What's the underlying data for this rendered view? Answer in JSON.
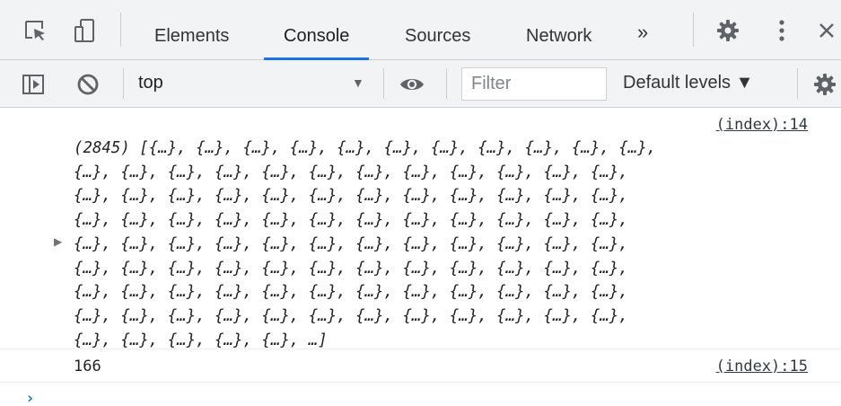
{
  "tabbar": {
    "tabs": [
      {
        "label": "Elements"
      },
      {
        "label": "Console"
      },
      {
        "label": "Sources"
      },
      {
        "label": "Network"
      }
    ],
    "more_tabs_label": "»",
    "active_tab": "Console"
  },
  "toolbar": {
    "context_label": "top",
    "filter_placeholder": "Filter",
    "levels_label": "Default levels ▼"
  },
  "console": {
    "messages": [
      {
        "source": "(index):14",
        "lines": [
          "(2845) [{…}, {…}, {…}, {…}, {…}, {…}, {…}, {…}, {…}, {…}, {…},",
          "{…}, {…}, {…}, {…}, {…}, {…}, {…}, {…}, {…}, {…}, {…}, {…},",
          "{…}, {…}, {…}, {…}, {…}, {…}, {…}, {…}, {…}, {…}, {…}, {…},",
          "{…}, {…}, {…}, {…}, {…}, {…}, {…}, {…}, {…}, {…}, {…}, {…},",
          "{…}, {…}, {…}, {…}, {…}, {…}, {…}, {…}, {…}, {…}, {…}, {…},",
          "{…}, {…}, {…}, {…}, {…}, {…}, {…}, {…}, {…}, {…}, {…}, {…},",
          "{…}, {…}, {…}, {…}, {…}, {…}, {…}, {…}, {…}, {…}, {…}, {…},",
          "{…}, {…}, {…}, {…}, {…}, {…}, {…}, {…}, {…}, {…}, {…}, {…},",
          "{…}, {…}, {…}, {…}, {…}, …]"
        ]
      },
      {
        "value": "166",
        "source": "(index):15"
      }
    ],
    "prompt_symbol": "›"
  },
  "colors": {
    "accent": "#1a73e8",
    "toolbar_bg": "#f1f3f4",
    "border": "#cacdd1"
  },
  "icons": {
    "tabbar": [
      "inspect-element-icon",
      "device-toolbar-icon",
      "settings-gear-icon",
      "more-vertical-icon",
      "close-icon"
    ],
    "toolbar": [
      "sidebar-toggle-icon",
      "clear-console-icon",
      "eye-icon",
      "settings-gear-icon"
    ]
  }
}
